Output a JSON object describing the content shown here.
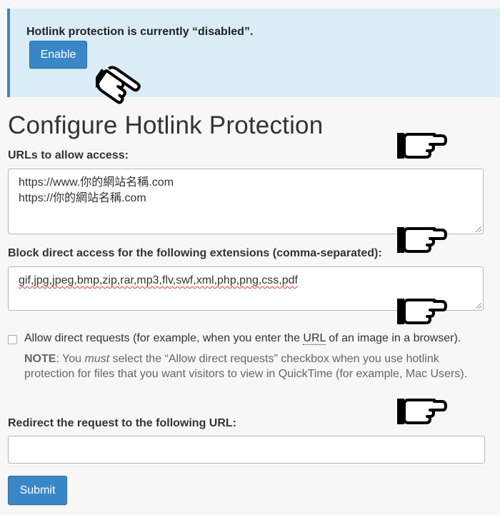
{
  "alert": {
    "message": "Hotlink protection is currently “disabled”.",
    "enable_label": "Enable"
  },
  "page_title": "Configure Hotlink Protection",
  "allow_urls": {
    "label": "URLs to allow access:",
    "lines": [
      "https://www.你的網站名稱.com",
      "https://你的網站名稱.com"
    ]
  },
  "extensions": {
    "label": "Block direct access for the following extensions (comma-separated):",
    "value": "gif,jpg,jpeg,bmp,zip,rar,mp3,flv,swf,xml,php,png,css,pdf"
  },
  "direct_requests": {
    "label_before": "Allow direct requests (for example, when you enter the ",
    "label_abbr": "URL",
    "label_after": " of an image in a browser).",
    "checked": false,
    "note_strong": "NOTE",
    "note_1": ": You ",
    "note_em": "must",
    "note_2": " select the “Allow direct requests” checkbox when you use hotlink protection for files that you want visitors to view in QuickTime (for example, Mac Users)."
  },
  "redirect": {
    "label": "Redirect the request to the following URL:",
    "value": ""
  },
  "submit_label": "Submit",
  "colors": {
    "alert_bg": "#daedf7",
    "accent": "#3a87c8",
    "page_bg": "#f7f7f7"
  },
  "icons": [
    "pointing-hand-icon"
  ]
}
